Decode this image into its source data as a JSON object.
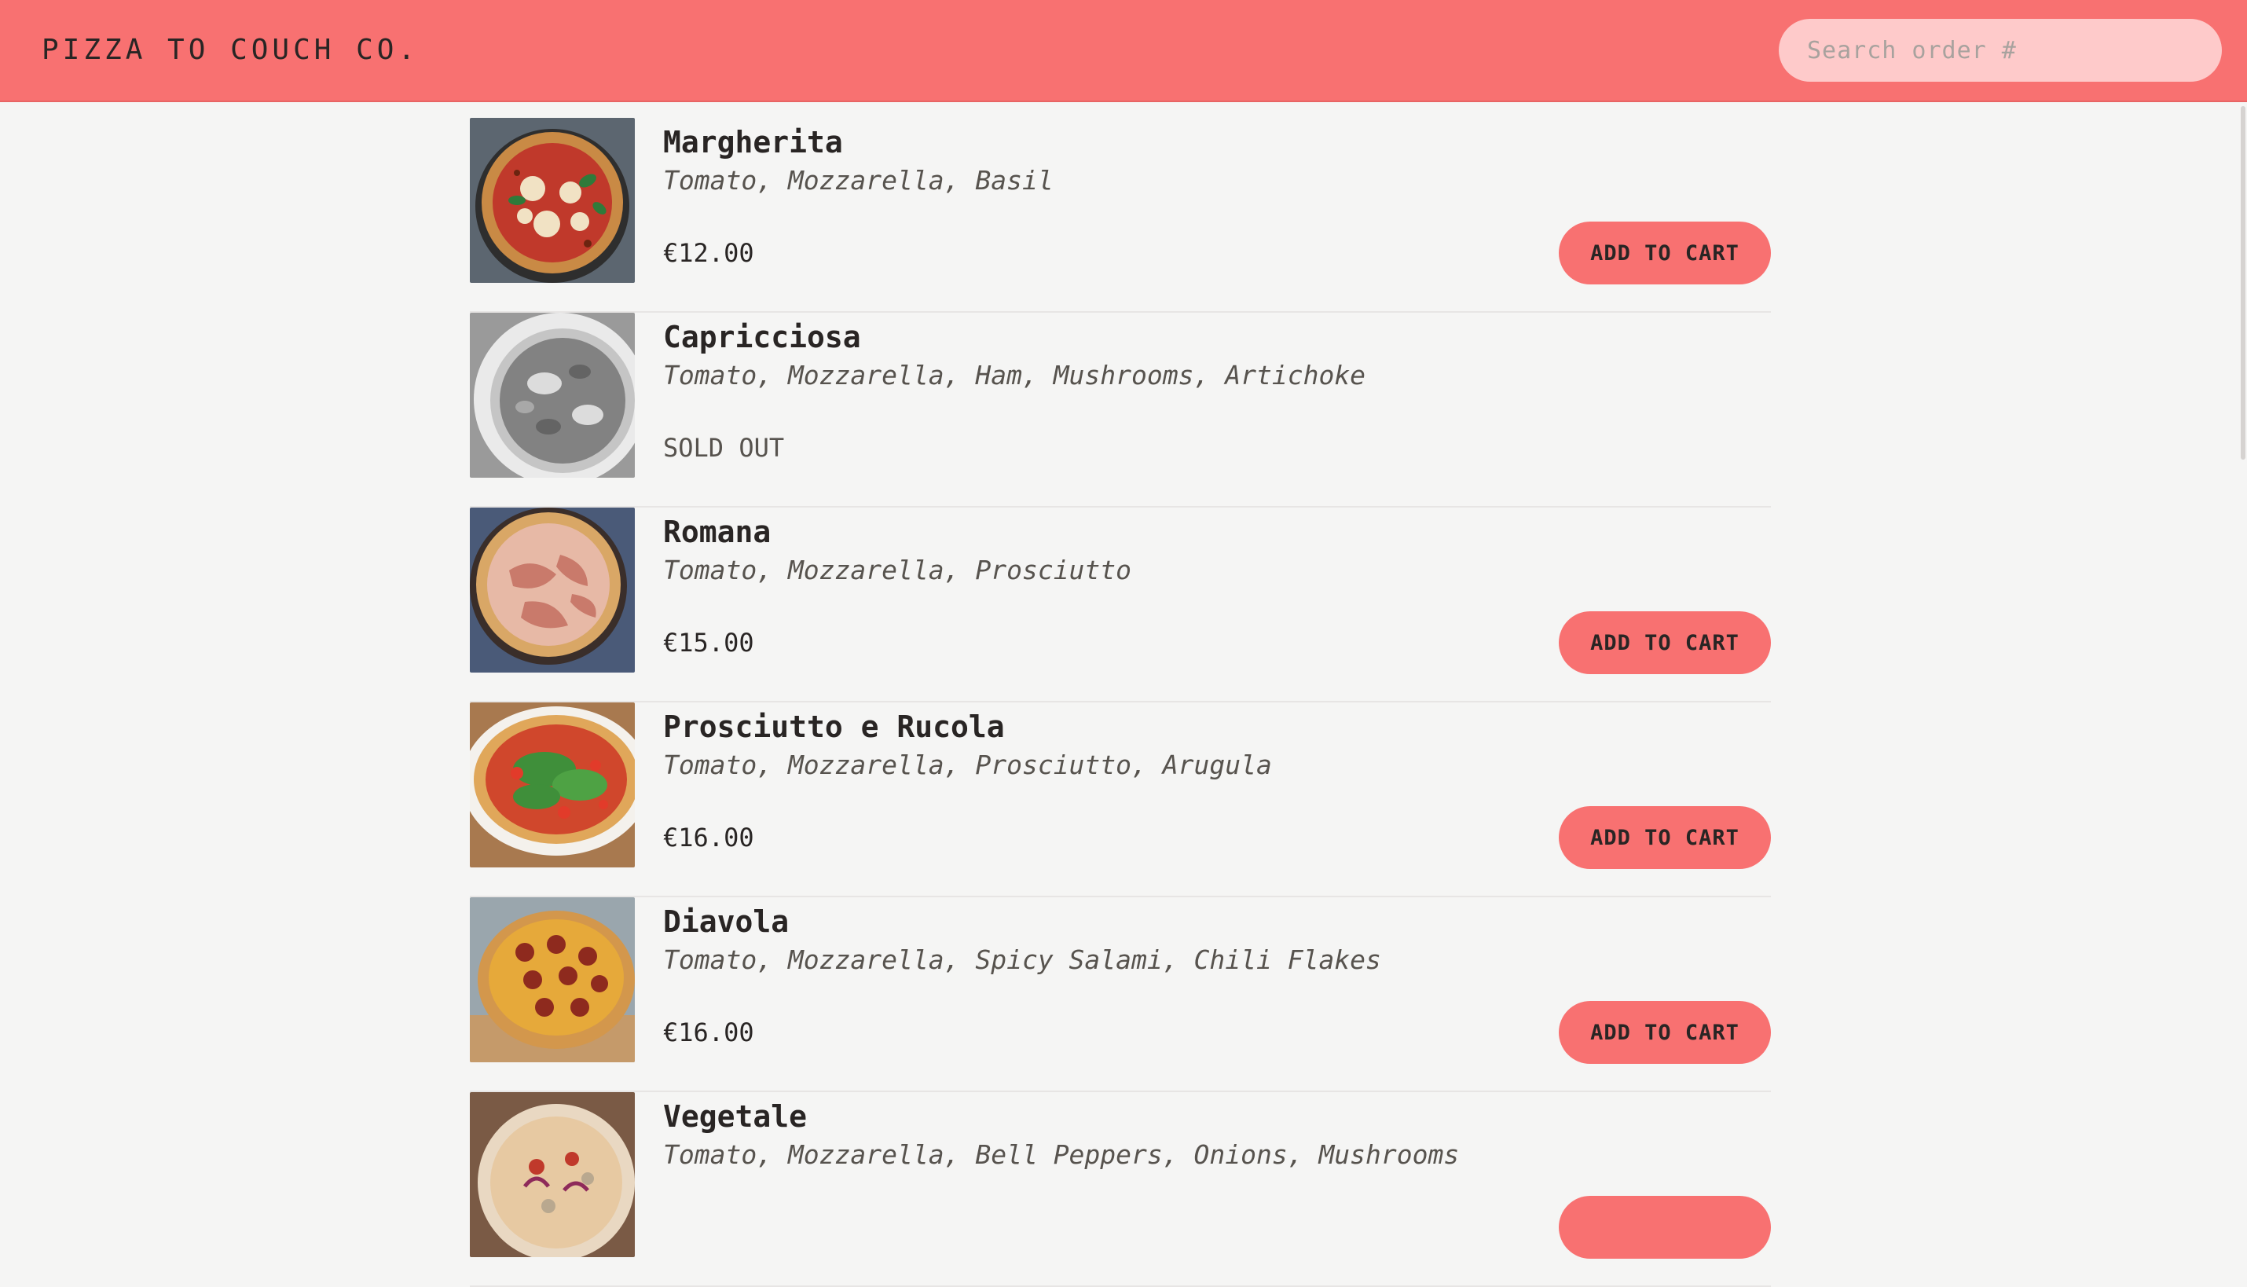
{
  "header": {
    "brand": "PIZZA TO COUCH CO.",
    "search_placeholder": "Search order #"
  },
  "colors": {
    "accent": "#f87171",
    "search_bg": "#fecaca",
    "page_bg": "#f5f5f4"
  },
  "menu": {
    "items": [
      {
        "name": "Margherita",
        "ingredients": "Tomato, Mozzarella, Basil",
        "price": "€12.00",
        "sold_out": false,
        "cart_label": "ADD TO CART",
        "image": "margherita-pizza-photo"
      },
      {
        "name": "Capricciosa",
        "ingredients": "Tomato, Mozzarella, Ham, Mushrooms, Artichoke",
        "price": "SOLD OUT",
        "sold_out": true,
        "cart_label": "",
        "image": "capricciosa-pizza-photo"
      },
      {
        "name": "Romana",
        "ingredients": "Tomato, Mozzarella, Prosciutto",
        "price": "€15.00",
        "sold_out": false,
        "cart_label": "ADD TO CART",
        "image": "romana-pizza-photo"
      },
      {
        "name": "Prosciutto e Rucola",
        "ingredients": "Tomato, Mozzarella, Prosciutto, Arugula",
        "price": "€16.00",
        "sold_out": false,
        "cart_label": "ADD TO CART",
        "image": "prosciutto-rucola-pizza-photo"
      },
      {
        "name": "Diavola",
        "ingredients": "Tomato, Mozzarella, Spicy Salami, Chili Flakes",
        "price": "€16.00",
        "sold_out": false,
        "cart_label": "ADD TO CART",
        "image": "diavola-pizza-photo"
      },
      {
        "name": "Vegetale",
        "ingredients": "Tomato, Mozzarella, Bell Peppers, Onions, Mushrooms",
        "price": "",
        "sold_out": false,
        "cart_label": "",
        "image": "vegetale-pizza-photo"
      }
    ]
  }
}
